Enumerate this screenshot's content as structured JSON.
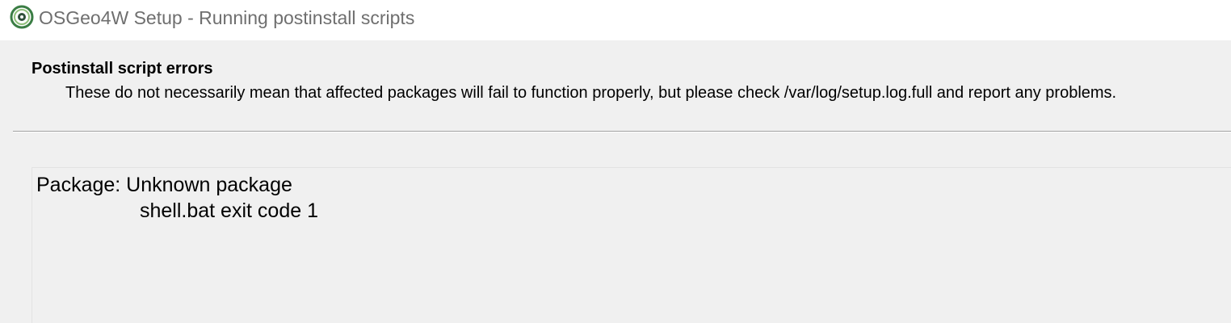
{
  "window": {
    "title": "OSGeo4W Setup - Running postinstall scripts",
    "icon": "osgeo4w-logo-icon"
  },
  "header": {
    "title": "Postinstall script errors",
    "subtitle": "These do not necessarily mean that affected packages will fail to function properly, but please check /var/log/setup.log.full and report any problems."
  },
  "errors": {
    "package_line": "Package: Unknown package",
    "detail_line": "shell.bat exit code 1"
  },
  "colors": {
    "background": "#f0f0f0",
    "titlebar": "#ffffff",
    "title_text": "#6f6f6f",
    "icon_green": "#3a7d44"
  }
}
